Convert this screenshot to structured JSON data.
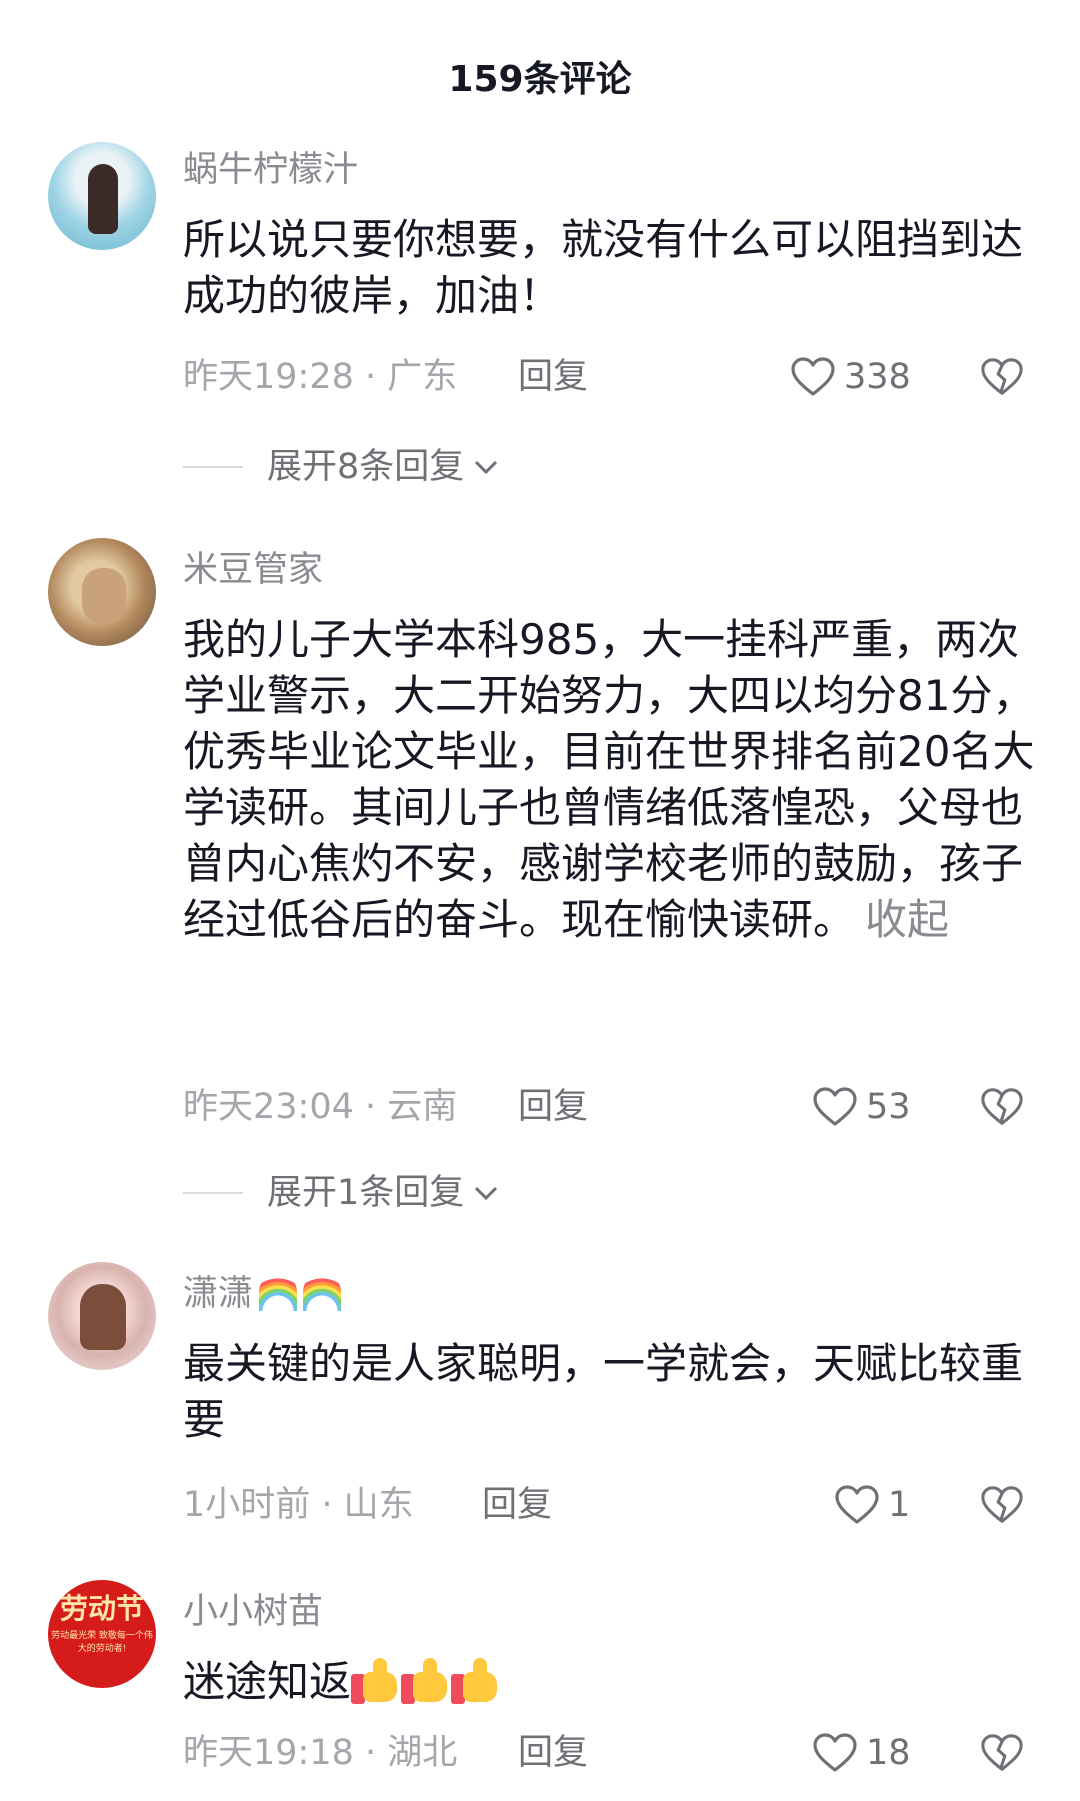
{
  "header": {
    "title": "159条评论"
  },
  "comments": [
    {
      "username": "蜗牛柠檬汁",
      "text": "所以说只要你想要，就没有什么可以阻挡到达成功的彼岸，加油！",
      "meta": "昨天19:28 · 广东",
      "reply": "回复",
      "likes": "338",
      "expand": "展开8条回复"
    },
    {
      "username": "米豆管家",
      "text": "我的儿子大学本科985，大一挂科严重，两次学业警示，大二开始努力，大四以均分81分，优秀毕业论文毕业，目前在世界排名前20名大学读研。其间儿子也曾情绪低落惶恐，父母也曾内心焦灼不安，感谢学校老师的鼓励，孩子经过低谷后的奋斗。现在愉快读研。",
      "collapse": "收起",
      "meta": "昨天23:04 · 云南",
      "reply": "回复",
      "likes": "53",
      "expand": "展开1条回复"
    },
    {
      "username": "潇潇",
      "text": "最关键的是人家聪明，一学就会，天赋比较重要",
      "meta": "1小时前 · 山东",
      "reply": "回复",
      "likes": "1"
    },
    {
      "username": "小小树苗",
      "text": "迷途知返",
      "meta": "昨天19:18 · 湖北",
      "reply": "回复",
      "likes": "18",
      "avatar_text": "劳动节",
      "avatar_subtext": "劳动最光荣 致敬每一个伟大的劳动者!"
    }
  ],
  "icons": {
    "like": "heart-outline-icon",
    "dislike": "broken-heart-icon",
    "expand": "chevron-down-icon",
    "emoji_rainbow": "rainbow-emoji-icon",
    "emoji_thumb": "thumbs-up-emoji-icon"
  },
  "colors": {
    "primary_text": "#161823",
    "secondary_text": "#8a8b91",
    "meta_text": "#a5a6ab"
  }
}
